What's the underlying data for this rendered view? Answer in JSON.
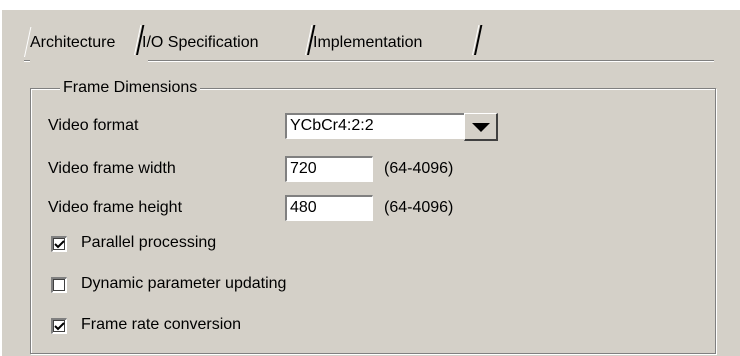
{
  "tabs": [
    {
      "label": "Architecture",
      "active": true
    },
    {
      "label": "I/O Specification",
      "active": false
    },
    {
      "label": "Implementation",
      "active": false
    }
  ],
  "frame_dimensions": {
    "title": "Frame Dimensions",
    "video_format": {
      "label": "Video format",
      "value": "YCbCr4:2:2"
    },
    "frame_width": {
      "label": "Video frame width",
      "value": "720",
      "range": "(64-4096)"
    },
    "frame_height": {
      "label": "Video frame height",
      "value": "480",
      "range": "(64-4096)"
    }
  },
  "options": [
    {
      "label": "Parallel processing",
      "checked": true
    },
    {
      "label": "Dynamic parameter updating",
      "checked": false
    },
    {
      "label": "Frame rate conversion",
      "checked": true
    }
  ],
  "colors": {
    "face": "#d4d0c8",
    "shadow": "#808080",
    "highlight": "#ffffff"
  }
}
